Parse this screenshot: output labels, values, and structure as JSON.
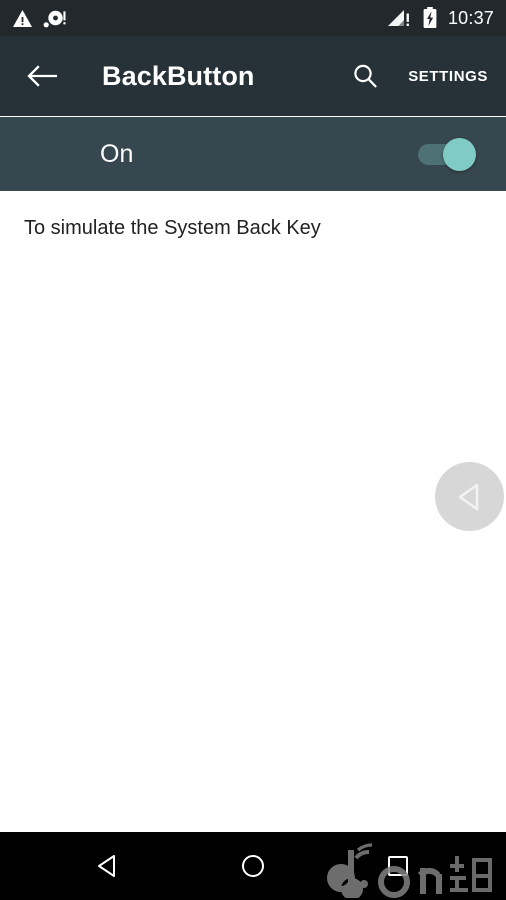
{
  "status_bar": {
    "time": "10:37",
    "left_icons": [
      {
        "name": "warning-triangle-icon",
        "label": "warning"
      },
      {
        "name": "notification-alert-icon",
        "label": "alert"
      }
    ],
    "right_icons": [
      {
        "name": "signal-no-service-icon",
        "label": "signal"
      },
      {
        "name": "battery-charging-icon",
        "label": "battery charging"
      }
    ],
    "background": "#23282c"
  },
  "app_bar": {
    "back_label": "Navigate up",
    "title": "BackButton",
    "search_label": "Search",
    "settings_label": "SETTINGS",
    "background": "#263238"
  },
  "switch_row": {
    "label": "On",
    "state": "on",
    "background": "#37474f",
    "thumb_color": "#80cbc4",
    "track_color": "#4d7175"
  },
  "content": {
    "description": "To simulate the System Back Key",
    "background": "#ffffff"
  },
  "floating_button": {
    "name": "floating-back-overlay",
    "label": "Back",
    "color": "rgba(160,160,160,0.42)"
  },
  "nav_bar": {
    "background": "#000000",
    "buttons": [
      {
        "name": "nav-back-button",
        "label": "Back"
      },
      {
        "name": "nav-home-button",
        "label": "Home"
      },
      {
        "name": "nav-recents-button",
        "label": "Recents"
      }
    ],
    "watermark": "d.cn 当乐网"
  }
}
